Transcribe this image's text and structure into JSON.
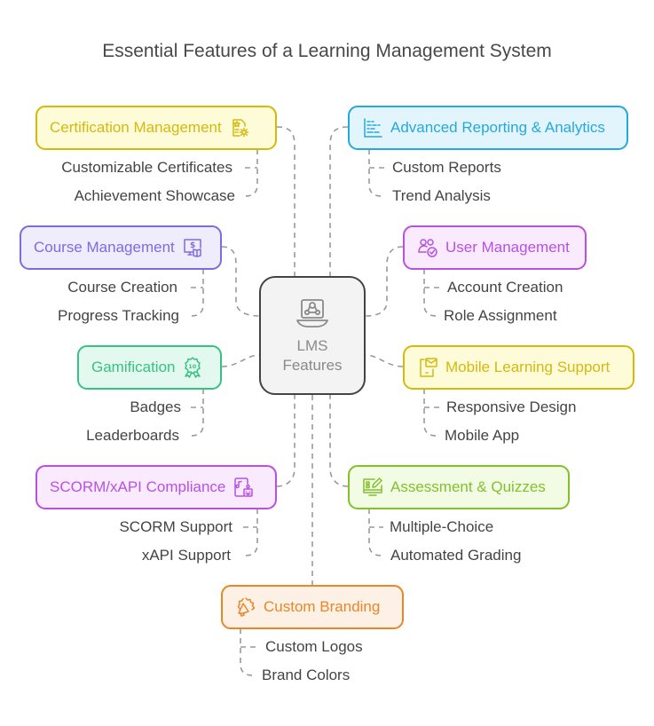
{
  "title": "Essential Features of a Learning Management System",
  "center": {
    "line1": "LMS",
    "line2": "Features",
    "icon": "laptop-users-icon"
  },
  "features": [
    {
      "id": "certification",
      "label": "Certification Management",
      "icon": "certificate-gear-icon",
      "color": "#d4b90f",
      "bg": "#fefbd8",
      "items": [
        "Customizable Certificates",
        "Achievement Showcase"
      ]
    },
    {
      "id": "reporting",
      "label": "Advanced Reporting & Analytics",
      "icon": "bar-chart-icon",
      "color": "#26a8dd",
      "bg": "#e3f5fc",
      "items": [
        "Custom Reports",
        "Trend Analysis"
      ]
    },
    {
      "id": "course",
      "label": "Course Management",
      "icon": "monitor-book-icon",
      "color": "#7d6be0",
      "bg": "#efedfc",
      "items": [
        "Course Creation",
        "Progress Tracking"
      ]
    },
    {
      "id": "user",
      "label": "User Management",
      "icon": "users-check-icon",
      "color": "#b851e0",
      "bg": "#f9ebfd",
      "items": [
        "Account Creation",
        "Role Assignment"
      ]
    },
    {
      "id": "gamification",
      "label": "Gamification",
      "icon": "award-badge-icon",
      "color": "#38c184",
      "bg": "#e3f9ef",
      "items": [
        "Badges",
        "Leaderboards"
      ]
    },
    {
      "id": "mobile",
      "label": "Mobile Learning Support",
      "icon": "mobile-mail-icon",
      "color": "#d4b90f",
      "bg": "#fefbd8",
      "items": [
        "Responsive Design",
        "Mobile App"
      ]
    },
    {
      "id": "scorm",
      "label": "SCORM/xAPI Compliance",
      "icon": "device-robot-icon",
      "color": "#b851e0",
      "bg": "#f9ebfd",
      "items": [
        "SCORM Support",
        "xAPI Support"
      ]
    },
    {
      "id": "assessment",
      "label": "Assessment & Quizzes",
      "icon": "monitor-edit-icon",
      "color": "#84c02d",
      "bg": "#f2fbe3",
      "items": [
        "Multiple-Choice",
        "Automated Grading"
      ]
    },
    {
      "id": "branding",
      "label": "Custom Branding",
      "icon": "megaphone-badge-icon",
      "color": "#e8862a",
      "bg": "#fdf1e5",
      "items": [
        "Custom Logos",
        "Brand Colors"
      ]
    }
  ]
}
